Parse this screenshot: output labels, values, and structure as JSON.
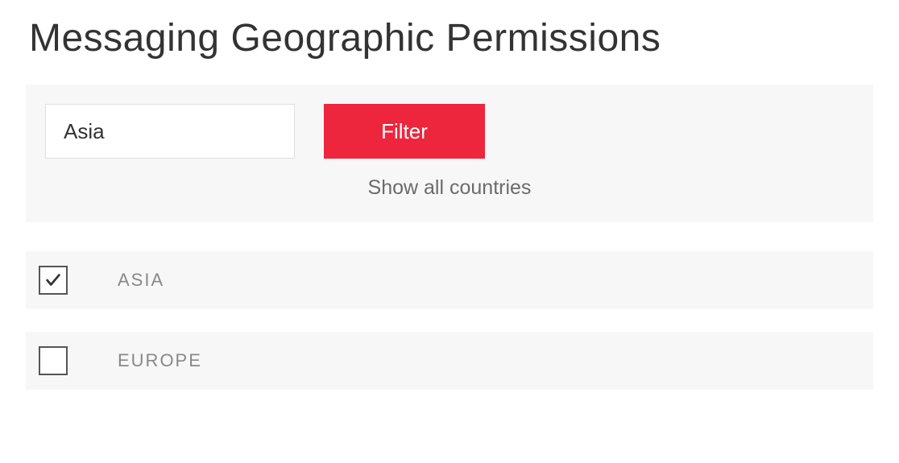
{
  "page": {
    "title": "Messaging Geographic Permissions"
  },
  "filter": {
    "input_value": "Asia",
    "button_label": "Filter",
    "show_all_label": "Show all countries"
  },
  "regions": [
    {
      "label": "ASIA",
      "checked": true
    },
    {
      "label": "EUROPE",
      "checked": false
    }
  ]
}
